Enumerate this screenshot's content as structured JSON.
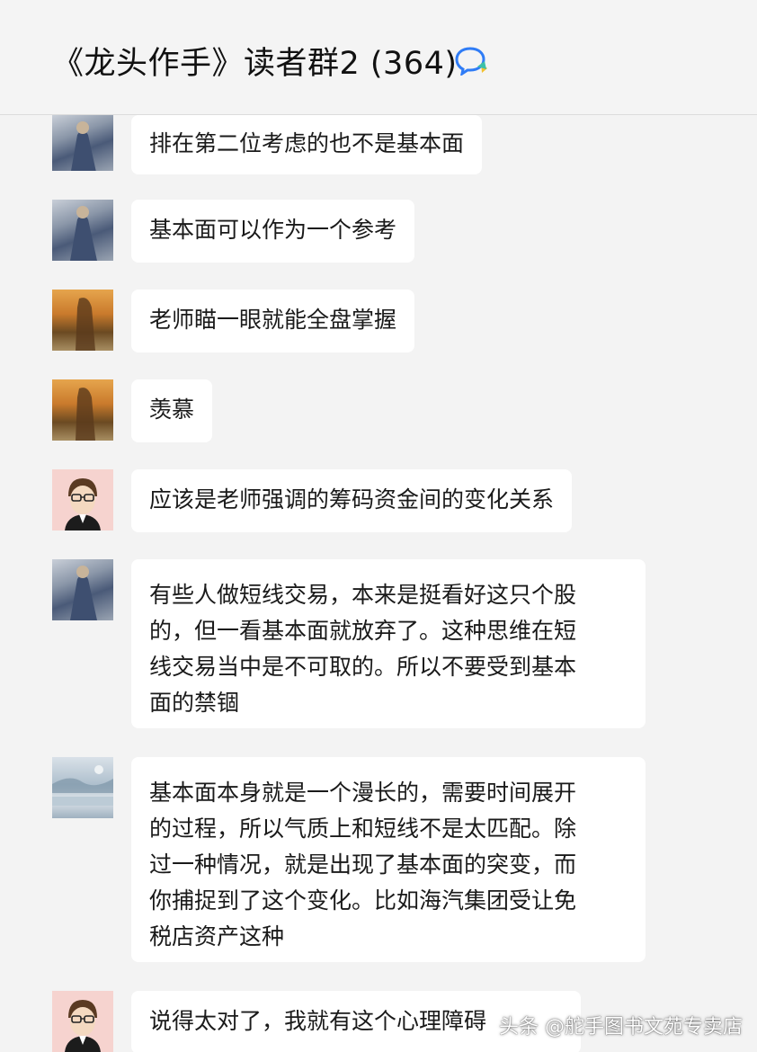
{
  "header": {
    "title": "《龙头作手》读者群2 (364)",
    "chat_icon": "chat-bubble-icon",
    "accent": "#2f7cf6"
  },
  "messages": [
    {
      "avatar": "monk-avatar",
      "text": "排在第二位考虑的也不是基本面"
    },
    {
      "avatar": "monk-avatar",
      "text": "基本面可以作为一个参考"
    },
    {
      "avatar": "sunset-avatar",
      "text": "老师瞄一眼就能全盘掌握"
    },
    {
      "avatar": "sunset-avatar",
      "text": "羡慕"
    },
    {
      "avatar": "glasses-man-avatar",
      "text": "应该是老师强调的筹码资金间的变化关系"
    },
    {
      "avatar": "monk-avatar",
      "lines": [
        "有些人做短线交易，本来是挺看好这只个股",
        "的，但一看基本面就放弃了。这种思维在短",
        "线交易当中是不可取的。所以不要受到基本",
        "面的禁锢"
      ]
    },
    {
      "avatar": "scenery-avatar",
      "lines": [
        "基本面本身就是一个漫长的，需要时间展开",
        "的过程，所以气质上和短线不是太匹配。除",
        "过一种情况，就是出现了基本面的突变，而",
        "你捕捉到了这个变化。比如海汽集团受让免",
        "税店资产这种"
      ]
    },
    {
      "avatar": "glasses-man-avatar",
      "text": "说得太对了，我就有这个心理障碍"
    }
  ],
  "watermark": "头条 @舵手图书文苑专卖店"
}
